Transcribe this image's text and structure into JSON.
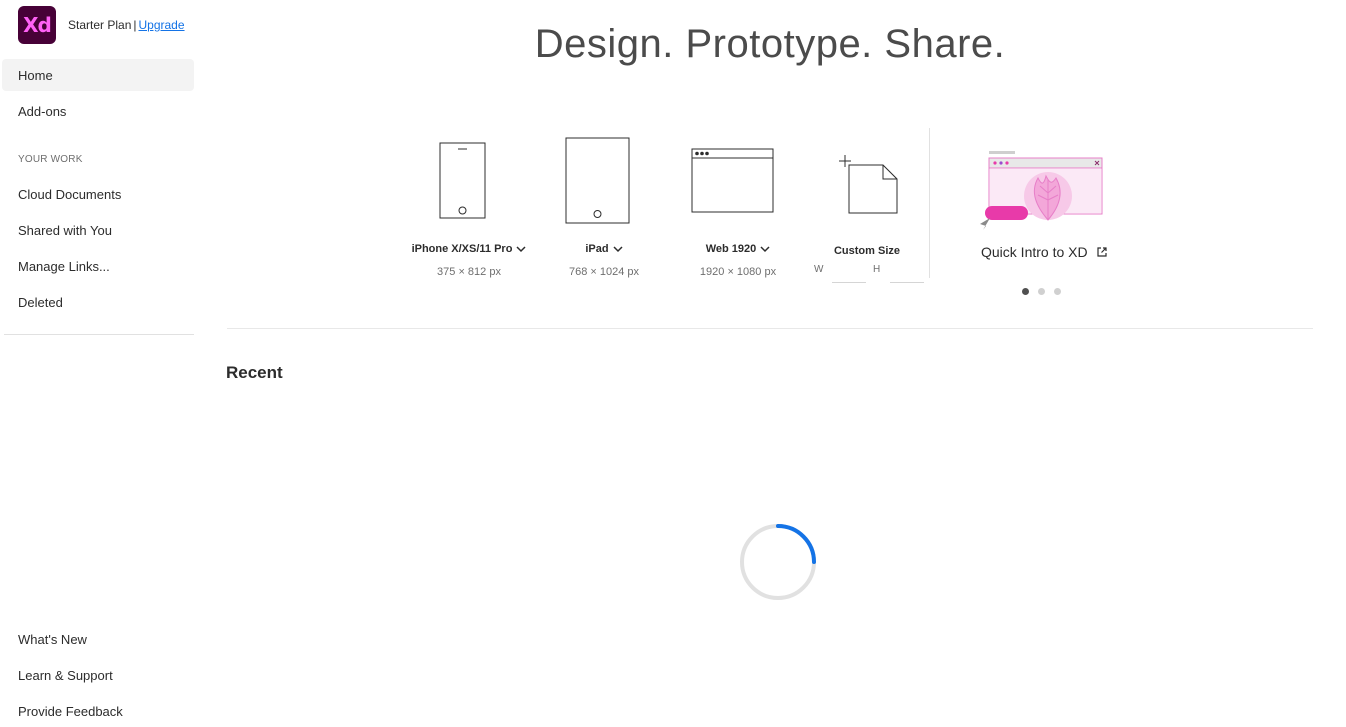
{
  "sidebar": {
    "logo_text": "Xd",
    "plan": "Starter Plan",
    "separator": "|",
    "upgrade": "Upgrade",
    "nav": {
      "home": "Home",
      "addons": "Add-ons"
    },
    "section_label": "YOUR WORK",
    "work": {
      "cloud": "Cloud Documents",
      "shared": "Shared with You",
      "links": "Manage Links...",
      "deleted": "Deleted"
    },
    "bottom": {
      "whats_new": "What's New",
      "learn": "Learn & Support",
      "feedback": "Provide Feedback"
    }
  },
  "main": {
    "headline": "Design. Prototype. Share.",
    "presets": {
      "iphone": {
        "name": "iPhone X/XS/11 Pro",
        "dims": "375 × 812 px"
      },
      "ipad": {
        "name": "iPad",
        "dims": "768 × 1024 px"
      },
      "web": {
        "name": "Web 1920",
        "dims": "1920 × 1080 px"
      },
      "custom": {
        "name": "Custom Size",
        "w_label": "W",
        "h_label": "H"
      }
    },
    "intro": {
      "title": "Quick Intro to XD"
    },
    "carousel": {
      "count": 3,
      "active": 0
    },
    "recent_title": "Recent"
  },
  "colors": {
    "brand_bg": "#470137",
    "brand_fg": "#ff61f6",
    "link": "#1473e6",
    "spinner": "#1473e6",
    "accent_pink": "#e83aa9"
  }
}
